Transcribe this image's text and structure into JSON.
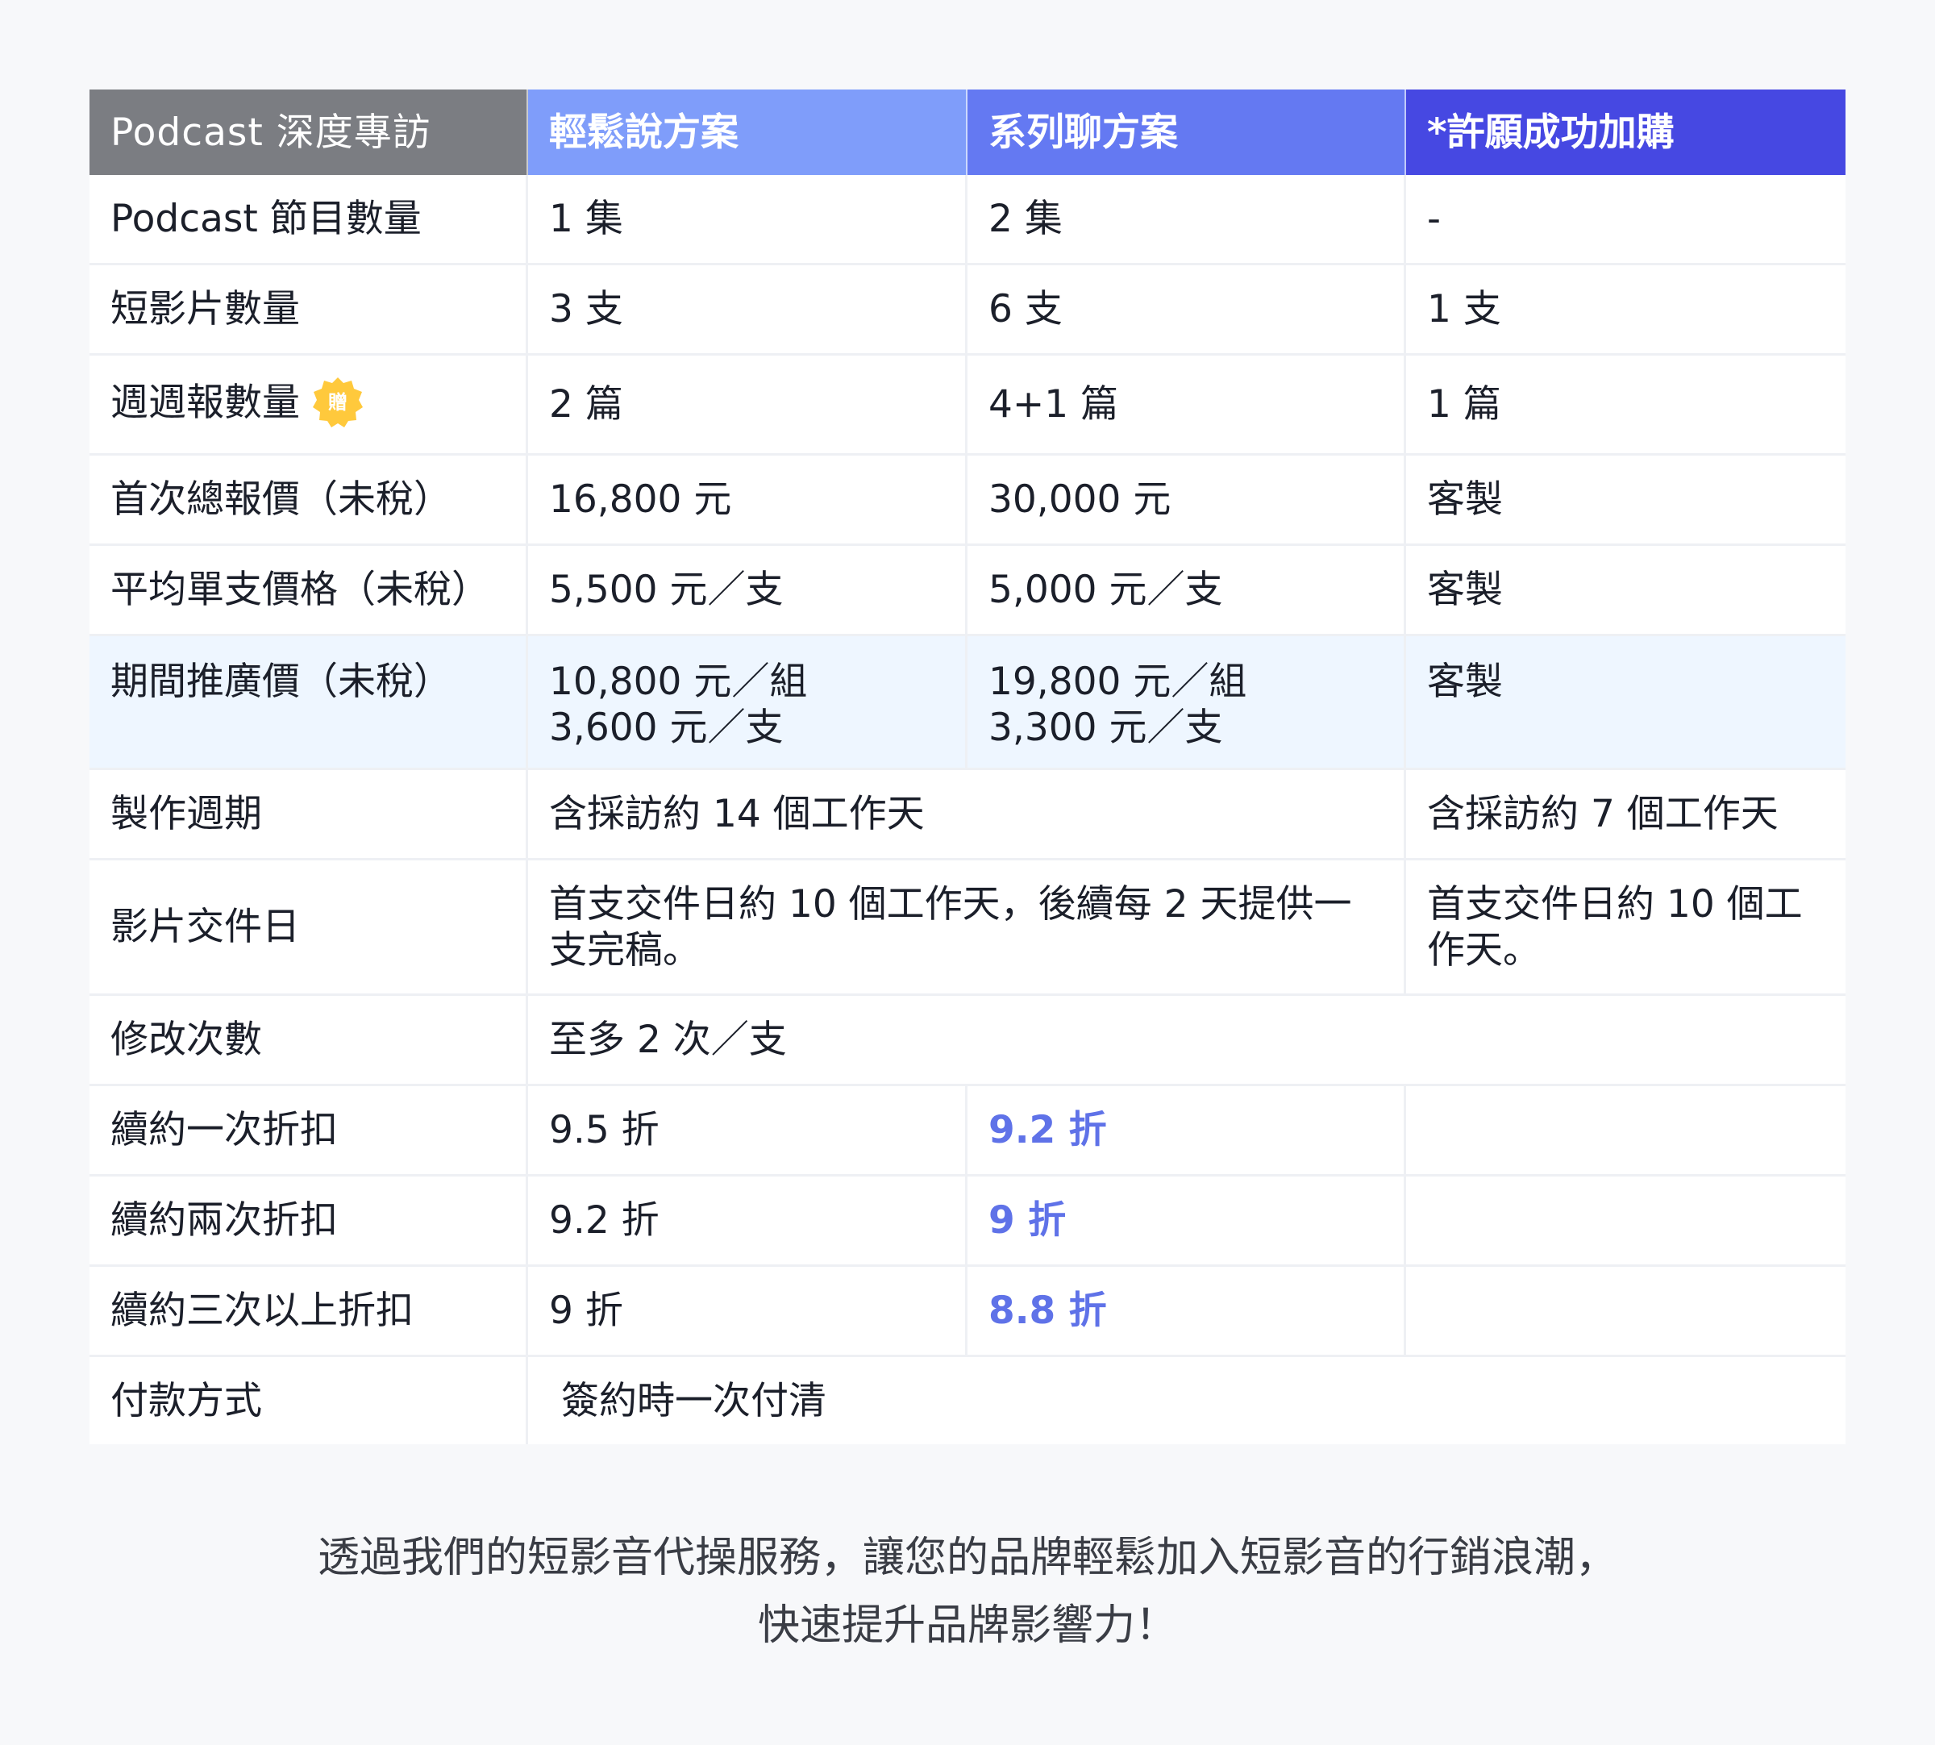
{
  "header": {
    "col1": "Podcast 深度專訪",
    "col2": "輕鬆說方案",
    "col3": "系列聊方案",
    "col4": "*許願成功加購"
  },
  "rows": {
    "episodes": {
      "label": "Podcast 節目數量",
      "a": "1 集",
      "b": "2 集",
      "c": "-"
    },
    "shorts": {
      "label": "短影片數量",
      "a": "3 支",
      "b": "6 支",
      "c": "1 支"
    },
    "weekly": {
      "label": "週週報數量",
      "badge": "贈",
      "a": "2 篇",
      "b": "4+1 篇",
      "c": "1 篇"
    },
    "total_price": {
      "label": "首次總報價（未稅）",
      "a": "16,800 元",
      "b": "30,000 元",
      "c": "客製"
    },
    "unit_price": {
      "label": "平均單支價格（未稅）",
      "a": "5,500 元／支",
      "b": "5,000 元／支",
      "c": "客製"
    },
    "promo_price": {
      "label": "期間推廣價（未稅）",
      "a1": "10,800 元／組",
      "a2": "3,600 元／支",
      "b1": "19,800 元／組",
      "b2": "3,300 元／支",
      "c": "客製"
    },
    "cycle": {
      "label": "製作週期",
      "ab": "含採訪約 14 個工作天",
      "c": "含採訪約 7 個工作天"
    },
    "delivery": {
      "label": "影片交件日",
      "ab1": "首支交件日約 10 個工作天，後續每 2 天提供一",
      "ab2": "支完稿。",
      "c1": "首支交件日約 10 個工",
      "c2": "作天。"
    },
    "revisions": {
      "label": "修改次數",
      "value": "至多 2 次／支"
    },
    "renew1": {
      "label": "續約一次折扣",
      "a": "9.5 折",
      "b": "9.2 折",
      "c": ""
    },
    "renew2": {
      "label": "續約兩次折扣",
      "a": "9.2 折",
      "b": "9 折",
      "c": ""
    },
    "renew3": {
      "label": "續約三次以上折扣",
      "a": "9 折",
      "b": "8.8 折",
      "c": ""
    },
    "payment": {
      "label": "付款方式",
      "value": " 簽約時一次付清"
    }
  },
  "tagline": {
    "line1": "透過我們的短影音代操服務，讓您的品牌輕鬆加入短影音的行銷浪潮，",
    "line2": "快速提升品牌影響力！"
  },
  "colors": {
    "header_gray": "#7b7d82",
    "header_light_blue": "#7f9dfa",
    "header_mid_blue": "#6479f2",
    "header_deep_blue": "#4648e2",
    "highlight_row": "#eef6ff",
    "accent_text": "#5f72e8",
    "badge": "#ffc93c"
  },
  "icons": {
    "gift_badge": "seal-badge-icon"
  }
}
